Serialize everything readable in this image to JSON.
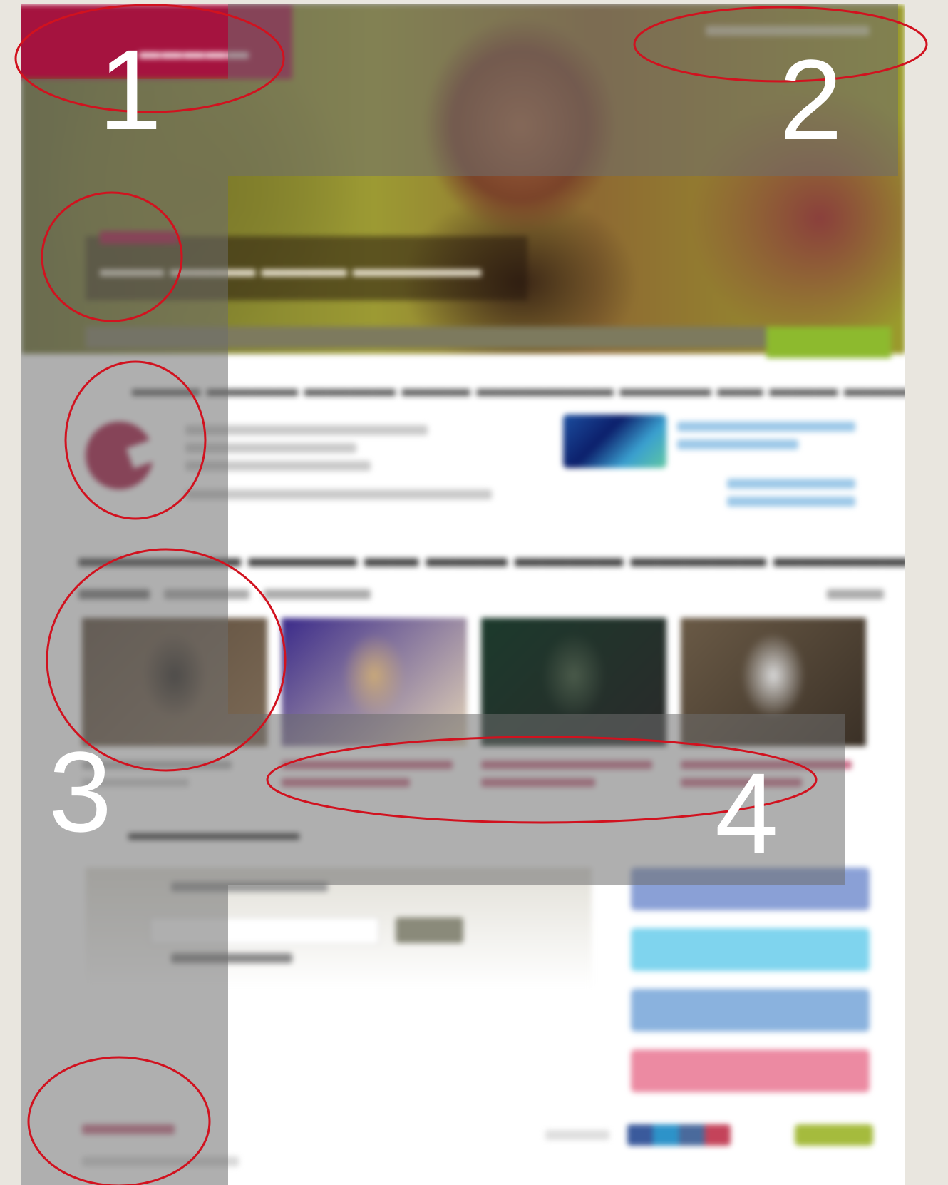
{
  "annotation_numbers": [
    "1",
    "2",
    "3",
    "4"
  ],
  "annotation_color": "#d1121f",
  "brand_color": "#a5133f",
  "accent_color": "#d4157b",
  "donate_color": "#8dba2e",
  "hero": {
    "logo_icon": "mercy-corps-logo",
    "progress": 0.0
  },
  "cards": [
    {
      "image": "portrait-woman-headscarf",
      "colors": [
        "#5a4a3a",
        "#2a2520",
        "#7c6a56"
      ]
    },
    {
      "image": "woman-in-purple-scarf",
      "colors": [
        "#3a2a8a",
        "#c8a87a",
        "#e2d2b6"
      ]
    },
    {
      "image": "people-in-shelter",
      "colors": [
        "#1c3a2c",
        "#4a5a4a",
        "#2a2a2a"
      ]
    },
    {
      "image": "man-in-white-cap",
      "colors": [
        "#6a5a46",
        "#d8d8d8",
        "#3a3026"
      ]
    }
  ],
  "social_buttons": [
    {
      "icon": "facebook-icon",
      "color": "#8aa0d6"
    },
    {
      "icon": "twitter-icon",
      "color": "#7fd4ee"
    },
    {
      "icon": "linkedin-icon",
      "color": "#8ab2de"
    },
    {
      "icon": "heart-icon",
      "color": "#ec8aa2"
    }
  ]
}
